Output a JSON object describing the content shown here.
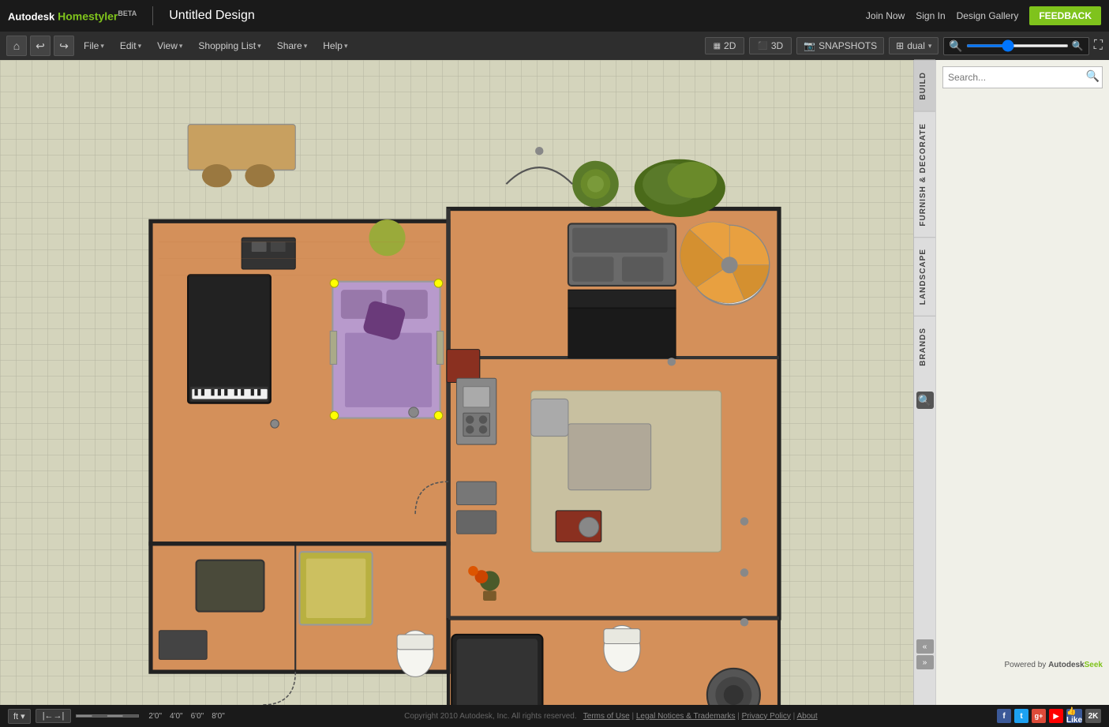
{
  "app": {
    "name": "Autodesk",
    "product": "Homestyler",
    "beta": "BETA",
    "title": "Untitled Design"
  },
  "topbar": {
    "join_now": "Join Now",
    "sign_in": "Sign In",
    "design_gallery": "Design Gallery",
    "feedback": "FEEDBACK"
  },
  "menubar": {
    "file": "File",
    "edit": "Edit",
    "view": "View",
    "shopping_list": "Shopping List",
    "share": "Share",
    "help": "Help",
    "view_2d": "2D",
    "view_3d": "3D",
    "snapshots": "SNAPSHOTS",
    "dual": "dual"
  },
  "right_panel": {
    "tabs": [
      {
        "id": "build",
        "label": "BUILD"
      },
      {
        "id": "furnish",
        "label": "FURNISH & DECORATE"
      },
      {
        "id": "landscape",
        "label": "LANDSCAPE"
      },
      {
        "id": "brands",
        "label": "BRANDS"
      }
    ],
    "search_placeholder": "Search..."
  },
  "footer": {
    "unit": "ft",
    "copyright": "Copyright 2010 Autodesk, Inc. All rights reserved.",
    "terms": "Terms of Use",
    "legal": "Legal Notices & Trademarks",
    "privacy": "Privacy Policy",
    "about": "About",
    "powered_by": "Powered by Autodesk Seek",
    "scale_marks": [
      "2'0\"",
      "4'0\"",
      "6'0\"",
      "8'0\""
    ]
  }
}
